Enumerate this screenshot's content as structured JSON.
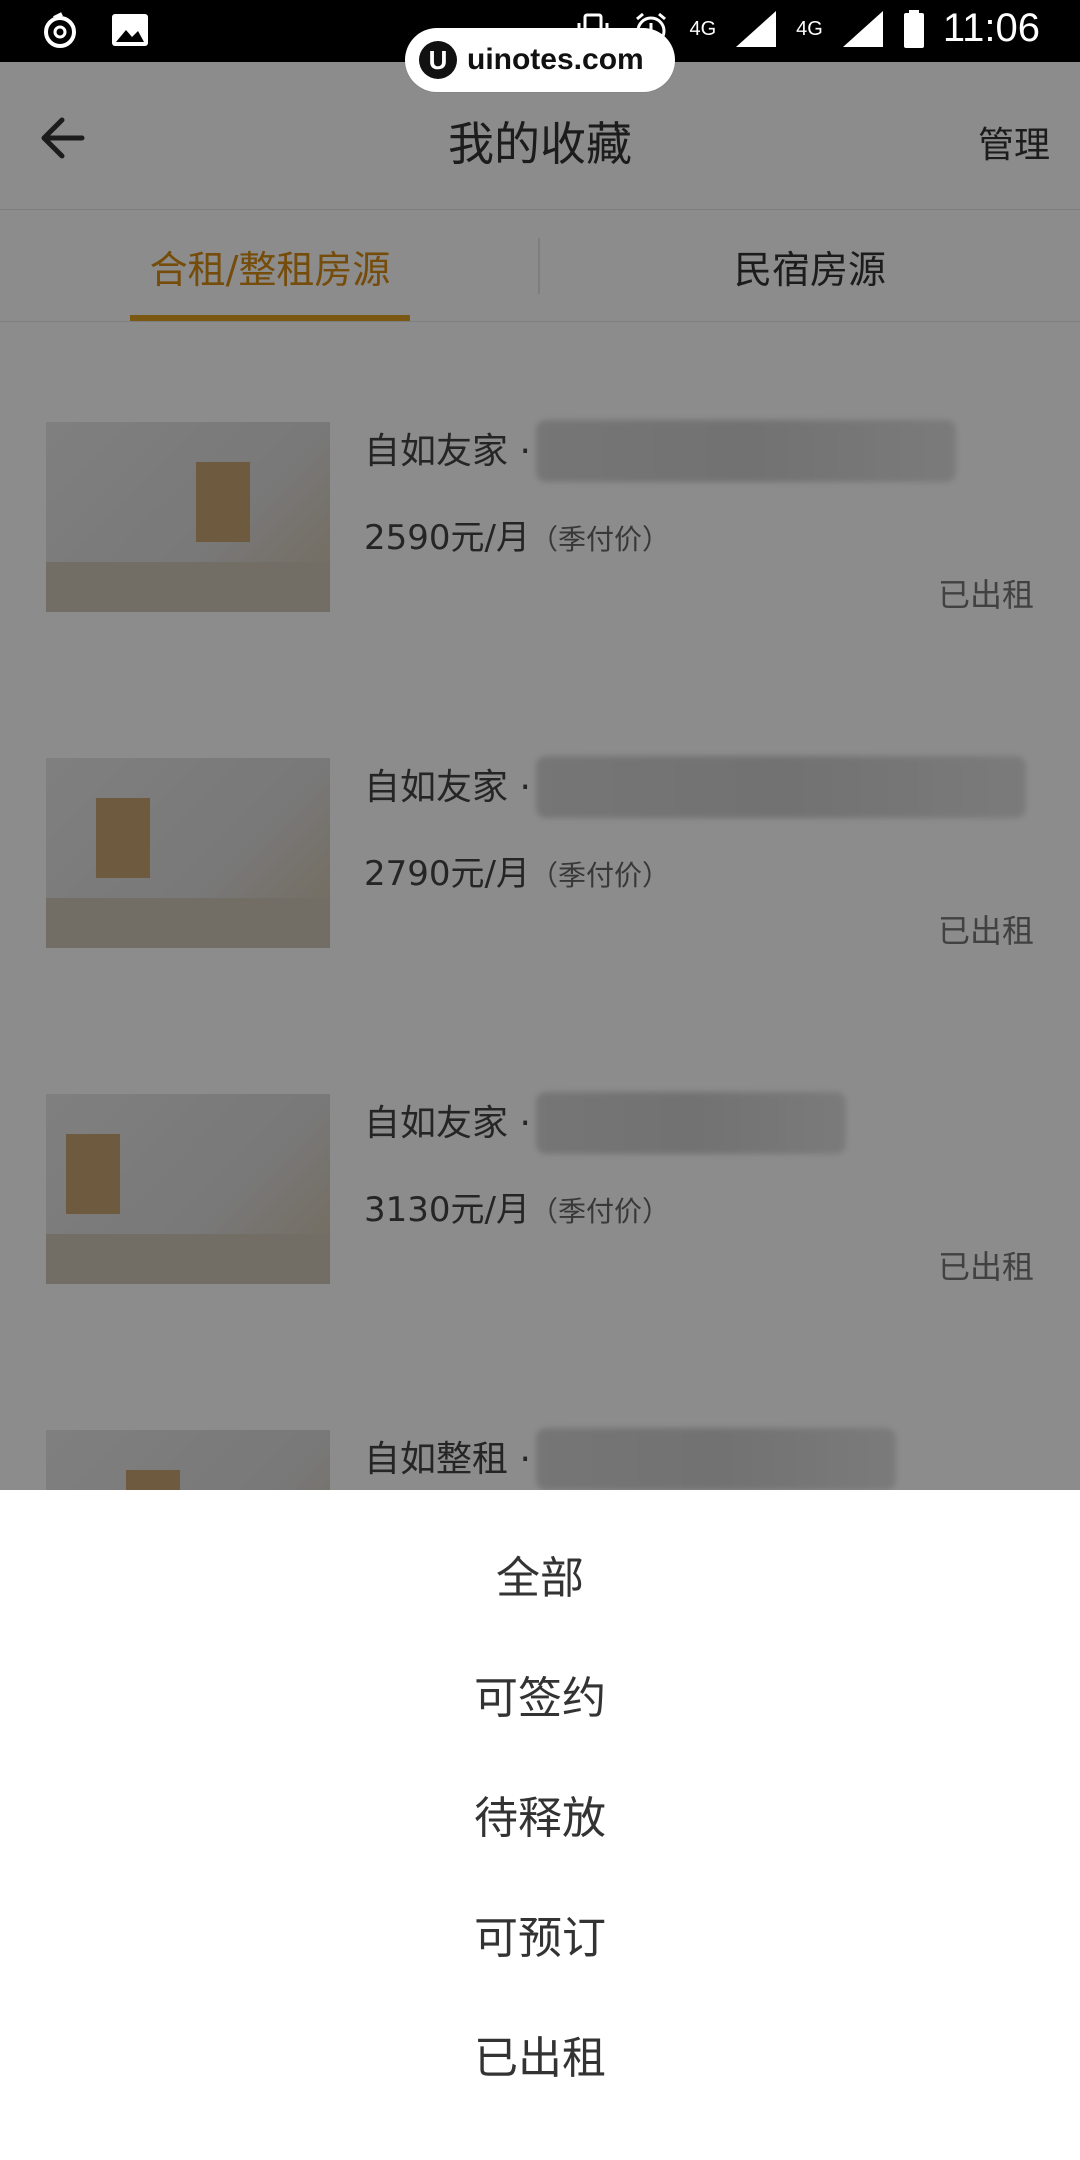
{
  "status_bar": {
    "time": "11:06",
    "network_1": "4G",
    "network_2": "4G",
    "icons": [
      "netease-icon",
      "image-icon",
      "vibrate-icon",
      "alarm-icon",
      "signal-icon",
      "signal-icon",
      "battery-icon"
    ]
  },
  "watermark": {
    "logo": "U",
    "text": "uinotes.com"
  },
  "header": {
    "title": "我的收藏",
    "manage_label": "管理",
    "back_icon": "arrow-left-icon"
  },
  "tabs": [
    {
      "label": "合租/整租房源",
      "active": true
    },
    {
      "label": "民宿房源",
      "active": false
    }
  ],
  "accent_color": "#d68a12",
  "listings": [
    {
      "name": "自如友家 ·",
      "price": "2590元/月",
      "price_note": "（季付价）",
      "status": "已出租"
    },
    {
      "name": "自如友家 ·",
      "price": "2790元/月",
      "price_note": "（季付价）",
      "status": "已出租"
    },
    {
      "name": "自如友家 ·",
      "price": "3130元/月",
      "price_note": "（季付价）",
      "status": "已出租"
    },
    {
      "name": "自如整租 ·",
      "price": "",
      "price_note": "",
      "status": ""
    }
  ],
  "filter_sheet": {
    "options": [
      "全部",
      "可签约",
      "待释放",
      "可预订",
      "已出租"
    ]
  }
}
